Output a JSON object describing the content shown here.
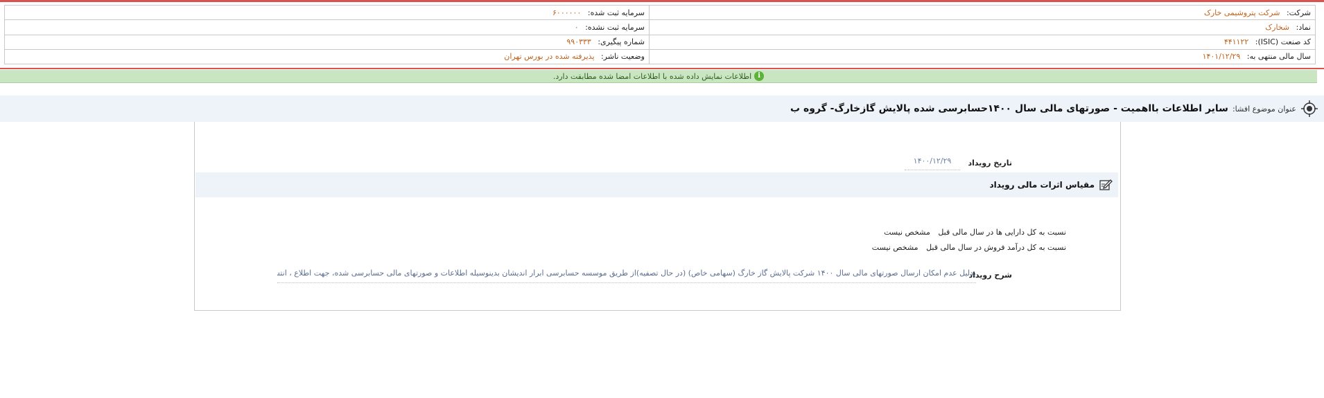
{
  "company": {
    "company_label": "شرکت:",
    "company_value": "شرکت پتروشیمی خارک",
    "symbol_label": "نماد:",
    "symbol_value": "شخارک",
    "isic_label": "کد صنعت (ISIC):",
    "isic_value": "۴۴۱۱۲۲",
    "fiscal_label": "سال مالی منتهی به:",
    "fiscal_value": "۱۴۰۱/۱۲/۲۹",
    "capital_registered_label": "سرمایه ثبت شده:",
    "capital_registered_value": "۶۰۰۰۰۰۰",
    "capital_unregistered_label": "سرمایه ثبت نشده:",
    "capital_unregistered_value": "۰",
    "tracking_label": "شماره پیگیری:",
    "tracking_value": "۹۹۰۳۳۳",
    "publisher_status_label": "وضعیت ناشر:",
    "publisher_status_value": "پذیرفته شده در بورس تهران"
  },
  "verify_message": "اطلاعات نمایش داده شده با اطلاعات امضا شده مطابقت دارد.",
  "subject": {
    "label": "عنوان موضوع افشا:",
    "title": "سایر اطلاعات بااهمیت - صورتهای مالی سال ۱۴۰۰حسابرسی شده پالایش گازخارگ- گروه ب"
  },
  "event": {
    "date_label": "تاریخ رویداد",
    "date_value": "۱۴۰۰/۱۲/۲۹",
    "measure_title": "مقیاس اثرات مالی رویداد",
    "assets_label": "نسبت به کل دارایی ها در سال مالی قبل",
    "assets_value": "مشخص نیست",
    "revenue_label": "نسبت به کل درآمد فروش در سال مالی قبل",
    "revenue_value": "مشخص نیست",
    "description_label": "شرح رویداد",
    "description_value": "بدلیل عدم امکان ارسال صورتهای مالی سال ۱۴۰۰ شرکت پالایش گاز خارگ (سهامی خاص) (در حال تصفیه)از طریق موسسه حسابرسی ابرار اندیشان بدینوسیله اطلاعات و صورتهای مالی حسابرسی شده، جهت اطلاع ، انتشار عموم می گردد."
  },
  "icons": {
    "info": "info-icon",
    "target": "target-icon",
    "edit": "edit-icon"
  },
  "colors": {
    "accent_red": "#d9534f",
    "value_orange": "#c0621b",
    "verify_bg": "#c9e5c1",
    "section_bg": "#eef3f9"
  }
}
